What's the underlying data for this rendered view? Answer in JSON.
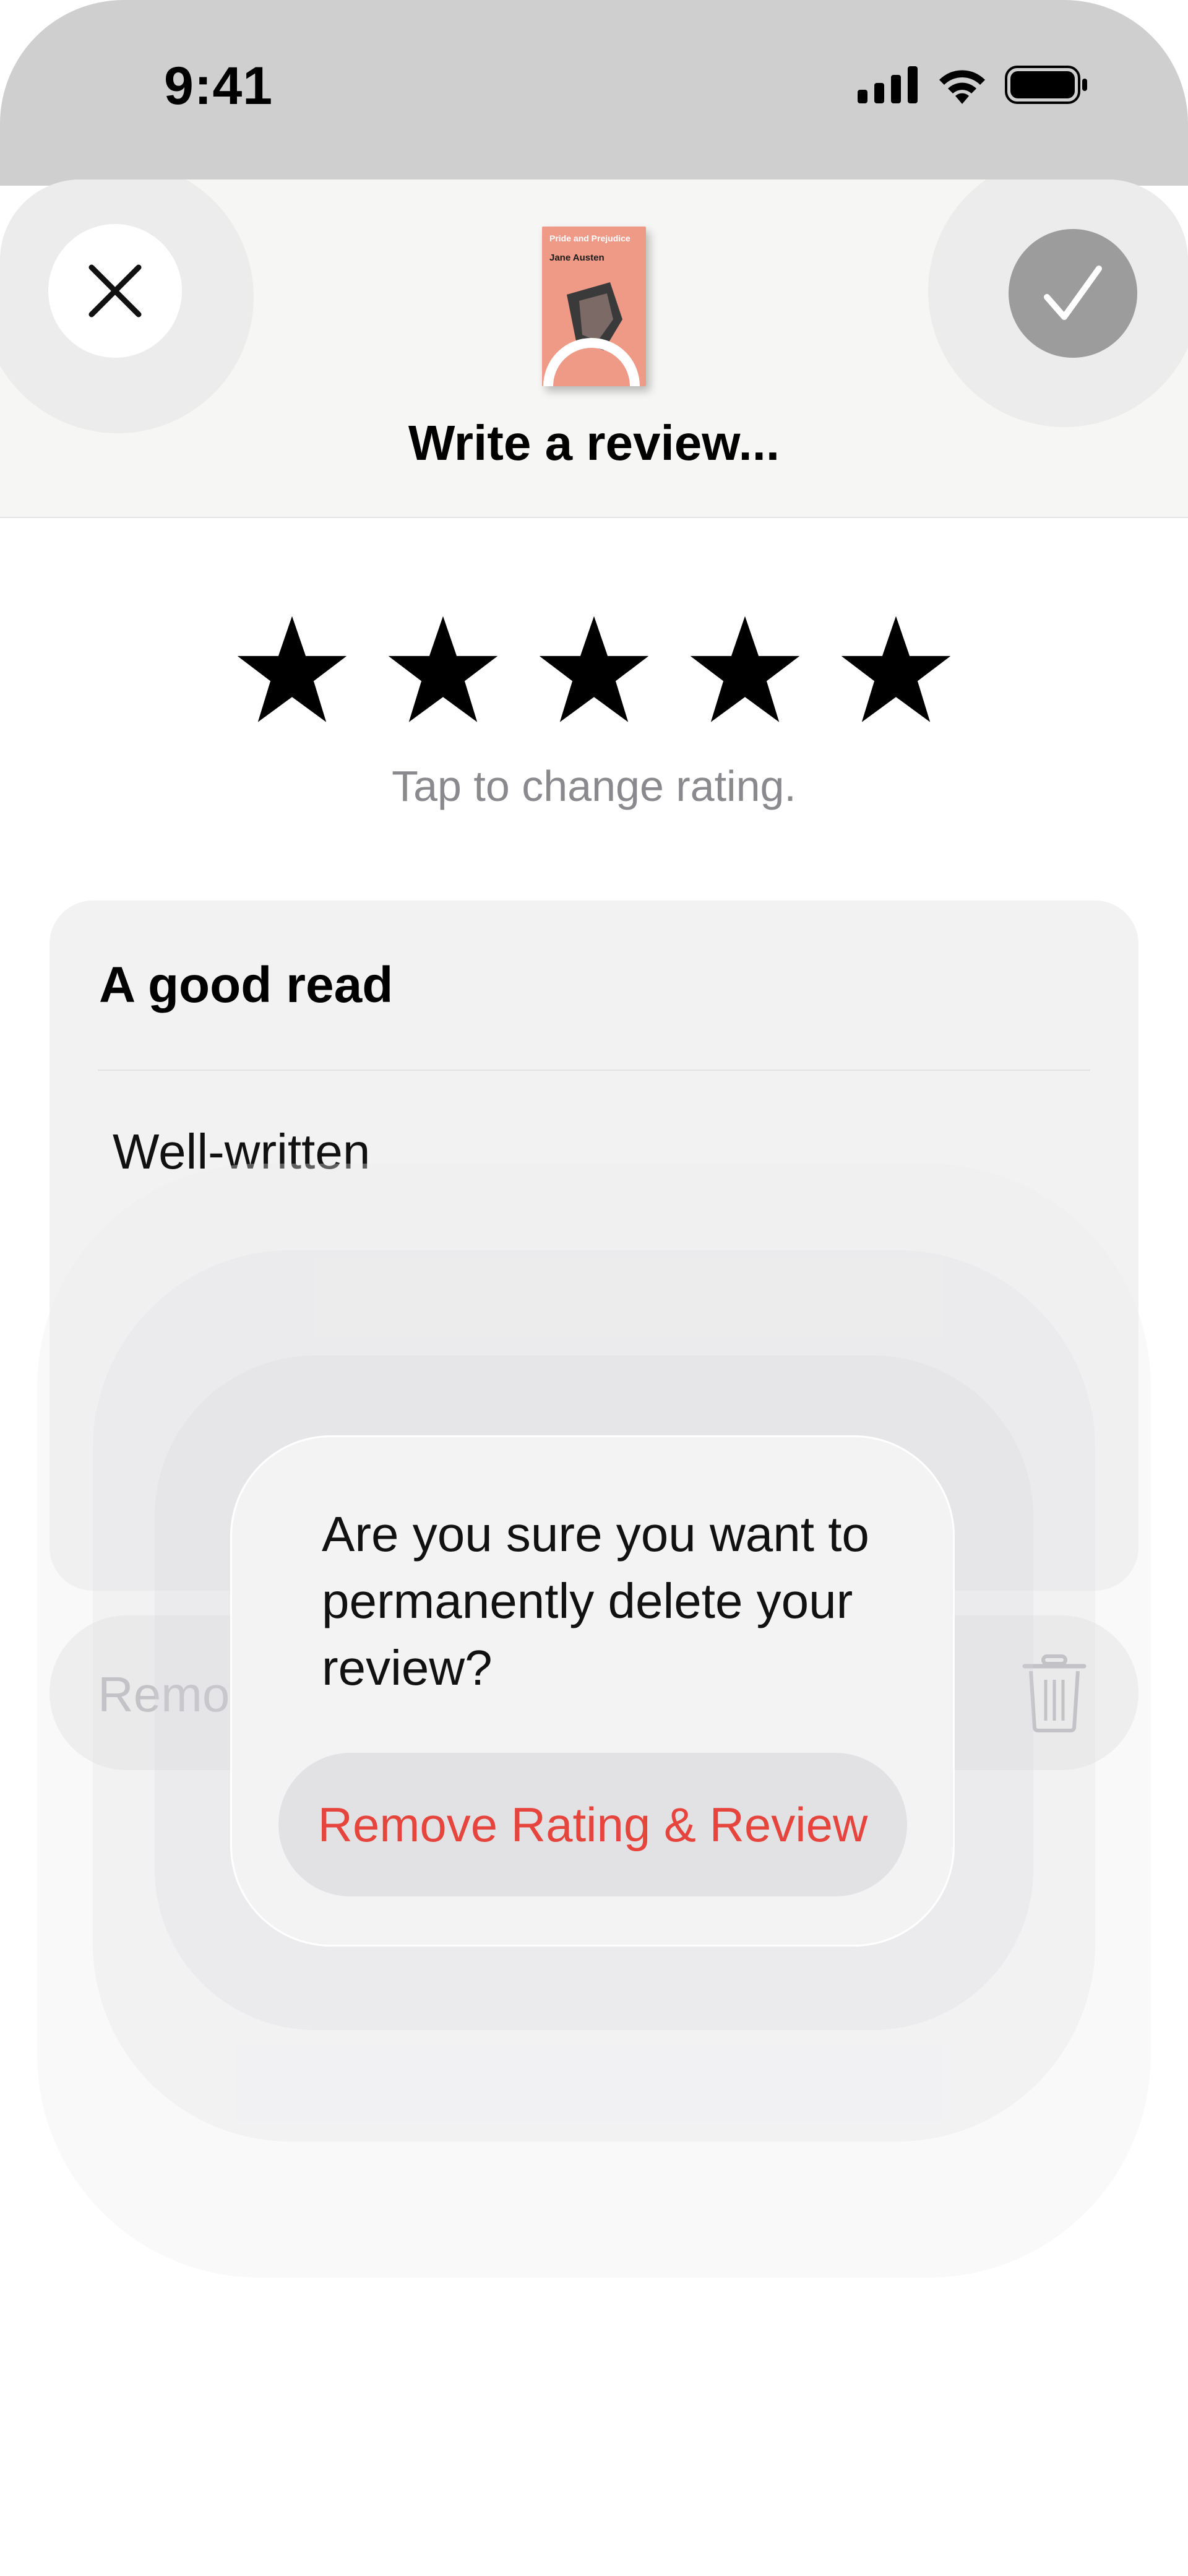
{
  "status_bar": {
    "time": "9:41"
  },
  "header": {
    "title": "Write a review...",
    "book": {
      "title": "Pride and Prejudice",
      "author": "Jane Austen"
    }
  },
  "rating": {
    "stars": 5,
    "max": 5,
    "hint": "Tap to change rating."
  },
  "review": {
    "title": "A good read",
    "body": "Well-written"
  },
  "remove_row": {
    "label": "Remove Rating & Review"
  },
  "alert": {
    "message": "Are you sure you want to permanently delete your review?",
    "action_label": "Remove Rating & Review"
  },
  "colors": {
    "destructive": "#e5453c",
    "secondary_text": "#8a8a8e",
    "done_button": "#9c9c9c",
    "book_cover": "#ee9a86"
  },
  "icons": [
    "close-icon",
    "checkmark-icon",
    "star-icon",
    "trash-icon",
    "signal-icon",
    "wifi-icon",
    "battery-icon"
  ]
}
